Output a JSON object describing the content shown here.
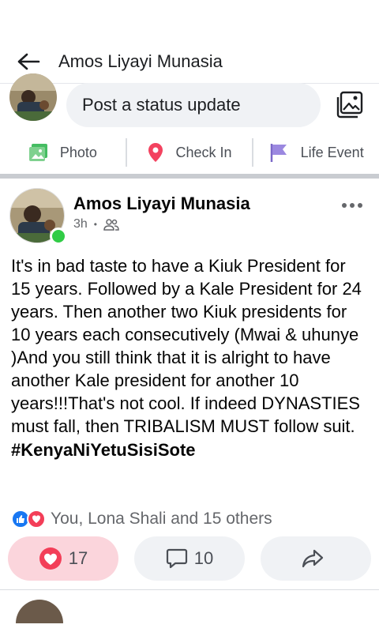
{
  "header": {
    "title": "Amos Liyayi Munasia"
  },
  "composer": {
    "placeholder": "Post a status update"
  },
  "actions": [
    {
      "label": "Photo",
      "icon": "photo-icon",
      "color": "#45bd62"
    },
    {
      "label": "Check In",
      "icon": "location-pin-icon",
      "color": "#f3425f"
    },
    {
      "label": "Life Event",
      "icon": "flag-icon",
      "color": "#7b68c8"
    }
  ],
  "post": {
    "author": "Amos Liyayi Munasia",
    "time": "3h",
    "audience_icon": "friends-icon",
    "text": "It's in bad taste to have a Kiuk President for 15  years. Followed by a Kale President for 24  years. Then another two Kiuk presidents for 10 years each consecutively  (Mwai & uhunye  )And you still think that it is alright to have another Kale president for another 10 years!!!That's not cool. If indeed DYNASTIES must fall, then TRIBALISM MUST follow suit.",
    "hashtag": "#KenyaNiYetuSisiSote",
    "reactions_summary": "You, Lona Shali and 15 others",
    "reaction_types": [
      "like",
      "love"
    ],
    "reaction_count": "17",
    "comment_count": "10"
  },
  "colors": {
    "love": "#f33e58",
    "like": "#1877f2",
    "online": "#31cc46"
  }
}
